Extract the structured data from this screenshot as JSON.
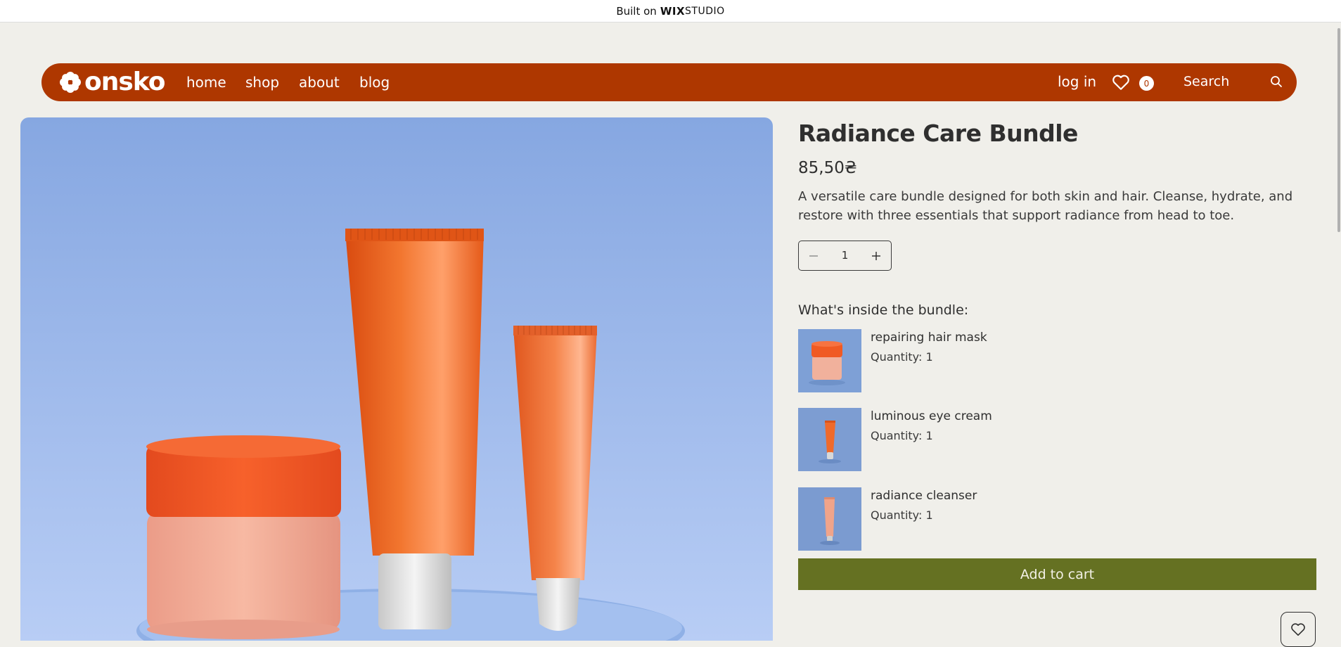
{
  "wix_banner": {
    "prefix": "Built on",
    "brand": "WIX",
    "suffix": "STUDIO"
  },
  "nav": {
    "logo": "onsko",
    "links": [
      "home",
      "shop",
      "about",
      "blog"
    ],
    "login": "log in",
    "wishlist_count": "0",
    "search": "Search"
  },
  "product": {
    "title": "Radiance Care Bundle",
    "price": "85,50₴",
    "description": "A versatile care bundle designed for both skin and hair. Cleanse, hydrate, and restore with three essentials that support radiance from head to toe.",
    "quantity": "1",
    "inside_title": "What's inside the bundle:",
    "items": [
      {
        "name": "repairing hair mask",
        "qty": "Quantity: 1"
      },
      {
        "name": "luminous eye cream",
        "qty": "Quantity: 1"
      },
      {
        "name": "radiance cleanser",
        "qty": "Quantity: 1"
      }
    ],
    "add_to_cart": "Add to cart"
  },
  "colors": {
    "brand": "#ae3700",
    "cta": "#657122",
    "background": "#f0efea",
    "product_orange": "#f26b2a",
    "photo_blue": "#8fb0e6"
  },
  "icons": [
    "logo-flower-icon",
    "heart-icon",
    "search-icon",
    "minus-icon",
    "plus-icon"
  ]
}
